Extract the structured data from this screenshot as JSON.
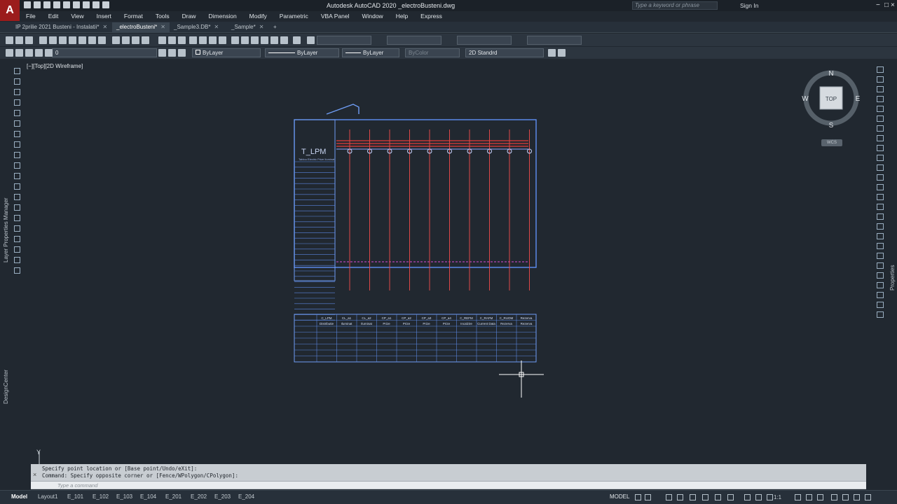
{
  "app": {
    "logo": "A",
    "title": "Autodesk AutoCAD 2020   _electroBusteni.dwg",
    "search_placeholder": "Type a keyword or phrase",
    "sign_in": "Sign In"
  },
  "menu": [
    "File",
    "Edit",
    "View",
    "Insert",
    "Format",
    "Tools",
    "Draw",
    "Dimension",
    "Modify",
    "Parametric",
    "VBA Panel",
    "Window",
    "Help",
    "Express"
  ],
  "tabs": [
    {
      "label": "IP 2prilie 2021 Busteni - Instalatii*",
      "active": false
    },
    {
      "label": "_electroBusteni*",
      "active": true
    },
    {
      "label": "_Sample3.DB*",
      "active": false
    },
    {
      "label": "_Sample*",
      "active": false
    }
  ],
  "tab_close": "✕",
  "new_tab": "+",
  "properties": {
    "layer": "0",
    "color": "ByLayer",
    "linetype": "ByLayer",
    "lineweight": "ByLayer",
    "plotstyle": "ByColor",
    "dimstyle": "2D Standrd"
  },
  "viewport": {
    "label": "[−][Top][2D Wireframe]"
  },
  "viewcube": {
    "n": "N",
    "s": "S",
    "e": "E",
    "w": "W",
    "face": "TOP",
    "ucs": "WCS"
  },
  "palettes": {
    "left_label": "Layer Properties Manager",
    "left_label2": "DesignCenter",
    "right_label": "Properties"
  },
  "drawing": {
    "board_label": "T_LPM",
    "table_header": "Tablou Electric Prize Iluminat",
    "circuits": [
      {
        "code": "C_LPM",
        "name": "Distributie"
      },
      {
        "code": "CL_a1",
        "name": "Iluminat"
      },
      {
        "code": "CL_a2",
        "name": "Iluminat"
      },
      {
        "code": "CP_a1",
        "name": "Prize"
      },
      {
        "code": "CP_a2",
        "name": "Prize"
      },
      {
        "code": "CP_a3",
        "name": "Prize"
      },
      {
        "code": "CP_a4",
        "name": "Prize"
      },
      {
        "code": "C_REFM",
        "name": "Incalzire"
      },
      {
        "code": "C_RAFM",
        "name": "Current Data"
      },
      {
        "code": "C_RUOM",
        "name": "Rezerva"
      },
      {
        "code": "Rezerva",
        "name": "Rezerva"
      }
    ]
  },
  "command": {
    "history": [
      "Specify point location or [Base point/Undo/eXit]:",
      "Command: Specify opposite corner or [Fence/WPolygon/CPolygon]:"
    ],
    "placeholder": "Type a command"
  },
  "status": {
    "layouts": [
      "Model",
      "Layout1",
      "E_101",
      "E_102",
      "E_103",
      "E_104",
      "E_201",
      "E_202",
      "E_203",
      "E_204"
    ],
    "model": "MODEL",
    "scale": "1:1"
  }
}
